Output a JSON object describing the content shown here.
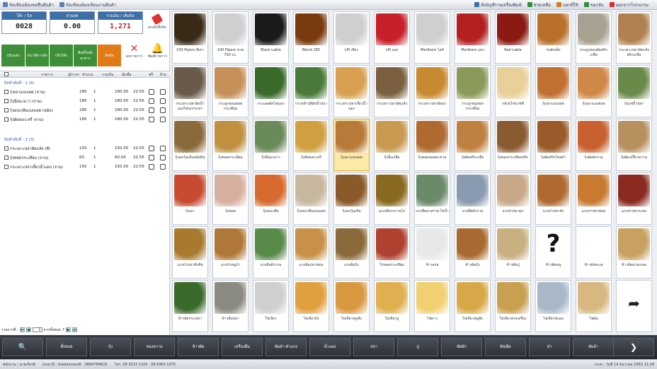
{
  "topbar": {
    "left_links": [
      {
        "label": "ข้อเขียนห้องขอชื่นสินค้า",
        "icon": "sheet-icon"
      },
      {
        "label": "ข้อเขียนห้องเขียนงานสินค้า",
        "icon": "sheet-icon"
      }
    ],
    "right_links": [
      {
        "label": "สั่งบัญชีรายเครื่องพิมพ์",
        "icon": "printer-icon"
      },
      {
        "label": "ช่วยเหลือ",
        "icon": "help-icon"
      },
      {
        "label": "บอกที่ใช้",
        "icon": "info-icon"
      },
      {
        "label": "ขอกลับ",
        "icon": "back-icon"
      },
      {
        "label": "ออกจากโปรแกรม",
        "icon": "exit-icon"
      }
    ]
  },
  "totals": [
    {
      "label": "โต๊ะ / บิล",
      "value": "0028"
    },
    {
      "label": "ส่วนลด",
      "value": "0.00"
    },
    {
      "label": "รวมเงิน / เติมบิล",
      "value": "1,271"
    }
  ],
  "erase_label": "ยกเลิกทั้งบิล",
  "actions": [
    {
      "label": "ปรับแต่ง",
      "color": "#3f8f3a"
    },
    {
      "label": "ประวัติการสั่ง",
      "color": "#3f8f3a"
    },
    {
      "label": "ปรับโต๊ะ",
      "color": "#3f8f3a"
    },
    {
      "label": "พิมพ์ใบสั่งอาหาร",
      "color": "#3f8f3a"
    },
    {
      "label": "ปิดบิล",
      "color": "#e07b18"
    }
  ],
  "ops": [
    {
      "label": "ลบรายการ",
      "glyph": "✕",
      "color": "#d33"
    },
    {
      "label": "พิมพ์รายการ",
      "glyph": "🔔",
      "color": "#f0a020"
    }
  ],
  "table_headers": [
    "รายการ",
    "@ราคา",
    "จำนวน",
    "รวมเงิน",
    "สั่งเมื่อ",
    "ฟรี",
    "ย้าย"
  ],
  "groups": [
    {
      "title": "บิลลำดับที่ : 1 (4)",
      "rows": [
        {
          "name": "กุ้งเผาแบบเดต (จาน)",
          "price": "180",
          "qty": "1",
          "total": "180.00",
          "time": "22:55"
        },
        {
          "name": "กุ้งนึ่งมะนาว (จาน)",
          "price": "180",
          "qty": "1",
          "total": "180.00",
          "time": "22:55"
        },
        {
          "name": "กุ้งอบเกลือแบบเดต (หม้อ)",
          "price": "180",
          "qty": "1",
          "total": "180.00",
          "time": "22:55"
        },
        {
          "name": "กุ้งผัดผงกะหรี่ (จาน)",
          "price": "180",
          "qty": "1",
          "total": "180.00",
          "time": "22:55"
        }
      ]
    },
    {
      "title": "บิลลำดับที่ : 2 (3)",
      "rows": [
        {
          "name": "กระเพาะปลาผัดแห้ง (ที่)",
          "price": "150",
          "qty": "1",
          "total": "150.00",
          "time": "22:55"
        },
        {
          "name": "กุ้งทอดกระเทียม (จาน)",
          "price": "60",
          "qty": "1",
          "total": "60.00",
          "time": "22:55"
        },
        {
          "name": "กระเพาะปลาเจี๋ยวน้ำแดง (จาน)",
          "price": "150",
          "qty": "1",
          "total": "150.00",
          "time": "22:55"
        }
      ]
    }
  ],
  "pager": {
    "label": "รายการที่ :",
    "page": "1",
    "suffix": "จากทั้งหมด",
    "total": "7"
  },
  "products": [
    {
      "name": "100 Pipers สีเทา",
      "c": "#3a2a18"
    },
    {
      "name": "100 Pipers ขวด 700 cc.",
      "c": "#cfcfcf"
    },
    {
      "name": "Black Lable",
      "c": "#1a1a1a"
    },
    {
      "name": "Blend 285",
      "c": "#7a3a10"
    },
    {
      "name": "LM เขียว",
      "c": "#cfcfcf"
    },
    {
      "name": "LM แดง",
      "c": "#c8202a"
    },
    {
      "name": "Marlboro ไลท์",
      "c": "#cfcfcf"
    },
    {
      "name": "Marlboro แดง",
      "c": "#b42020"
    },
    {
      "name": "Red Lable",
      "c": "#8a1a12"
    },
    {
      "name": "กบผัดเผ็ด",
      "c": "#b8702a"
    },
    {
      "name": "กระดูกอ่อนผัดพริกเกลือ",
      "c": "#a8a090"
    },
    {
      "name": "กระเพาะปลาผัดแห้งพริกเกลือ",
      "c": "#b08050"
    },
    {
      "name": "กระเพาะปลาผัดน้ำแดงไข่นกกระทา",
      "c": "#6a5a4a"
    },
    {
      "name": "กระดูกอ่อนทอดกระเทียม",
      "c": "#c69058"
    },
    {
      "name": "กระเฉดผัดไฟแดง",
      "c": "#3a6a2a"
    },
    {
      "name": "กระหล่ำปลีผัดน้ำปลา",
      "c": "#4a7a3a"
    },
    {
      "name": "กระเพาะปลาเจี๋ยวน้ำแดง",
      "c": "#d8a050"
    },
    {
      "name": "กระเพาะปลาผัดแห้ง",
      "c": "#7a6040"
    },
    {
      "name": "กระเพาะปลาผัดฉ่า",
      "c": "#c88a30"
    },
    {
      "name": "กระดูกหมูทอดกระเทียม",
      "c": "#8a9a5a"
    },
    {
      "name": "กล้วยไข่บวชชี",
      "c": "#e8d098"
    },
    {
      "name": "กุ้งเผาแบบเดต",
      "c": "#c07030"
    },
    {
      "name": "กุ้งเผาแบบซอส",
      "c": "#d08848"
    },
    {
      "name": "กุ้งแช่น้ำปลา",
      "c": "#6a8a4a"
    },
    {
      "name": "กุ้งอบวุ้นเส้นหม้อดิน",
      "c": "#8a6a3a"
    },
    {
      "name": "กุ้งทอดกระเทียม",
      "c": "#c09040"
    },
    {
      "name": "กุ้งนึ่งมะนาว",
      "c": "#6a8a5a"
    },
    {
      "name": "กุ้งผัดผงกะหรี่",
      "c": "#d0a040"
    },
    {
      "name": "กุ้งเผาแบบเดต",
      "c": "#b87a38"
    },
    {
      "name": "กุ้งนึ่งเกลือ",
      "c": "#c89a50"
    },
    {
      "name": "กุ้งทอดซอสมะขาม",
      "c": "#b06a30"
    },
    {
      "name": "กุ้งผัดพริกเกลือ",
      "c": "#c08040"
    },
    {
      "name": "กุ้งทอดกระเทียมพริก",
      "c": "#8a5a30"
    },
    {
      "name": "กุ้งผัดพริกไทยดำ",
      "c": "#9a5a2a"
    },
    {
      "name": "กุ้งผัดผักรวม",
      "c": "#c86030"
    },
    {
      "name": "กุ้งผัดเปรี้ยวหวาน",
      "c": "#b89060"
    },
    {
      "name": "กุ้งเผา",
      "c": "#c84a30"
    },
    {
      "name": "กุ้งทอด",
      "c": "#d8b0a0"
    },
    {
      "name": "กุ้งอบเกลือ",
      "c": "#d86a30"
    },
    {
      "name": "กุ้งอบเกลือแบบเดต",
      "c": "#c8b8a0"
    },
    {
      "name": "กุ้งอบวุ้นเส้น",
      "c": "#8a5a2a"
    },
    {
      "name": "แกงเขียวหวานไก่",
      "c": "#8a6a20"
    },
    {
      "name": "แกงจืดสาหร่าย-ไข่น้ำ",
      "c": "#6a8a6a"
    },
    {
      "name": "แกงจืดผักกาด",
      "c": "#8a9ab0"
    },
    {
      "name": "แกงป่าปลาดุก",
      "c": "#c8a888"
    },
    {
      "name": "แกงป่าปลาคัง",
      "c": "#b06a30"
    },
    {
      "name": "แกงป่าปลาช่อน",
      "c": "#c87a30"
    },
    {
      "name": "แกงป่าปลากะพง",
      "c": "#8a2a20"
    },
    {
      "name": "แกงป่าปลาทับทิม",
      "c": "#a87a30"
    },
    {
      "name": "แกงป่าหมูป่า",
      "c": "#b07838"
    },
    {
      "name": "แกงส้มผักรวม",
      "c": "#5a8a4a"
    },
    {
      "name": "แกงส้มปลาช่อน",
      "c": "#c89048"
    },
    {
      "name": "แกงส้มกุ้ง",
      "c": "#8a6a3a"
    },
    {
      "name": "ไก่ทอดกระเทียม",
      "c": "#b04030"
    },
    {
      "name": "ข้าวสวย",
      "c": "#e8e8e8"
    },
    {
      "name": "ข้าวผัดกุ้ง",
      "c": "#a86a30"
    },
    {
      "name": "ข้าวผัดปู",
      "c": "#c8b080"
    },
    {
      "name": "ข้าวผัดหมู",
      "c": "#d0b890"
    },
    {
      "name": "ข้าวผัดทะเล",
      "c": "#ffffff"
    },
    {
      "name": "ข้าวผัดสามเกลอ",
      "c": "#c8a060"
    },
    {
      "name": "ข้าวผัดกระเพรา",
      "c": "#3a6a2a"
    },
    {
      "name": "ข้าวต้มปลา",
      "c": "#8a8a80"
    },
    {
      "name": "ไข่เจียว",
      "c": "#cfcfcf"
    },
    {
      "name": "ไข่เจียวกุ้ง",
      "c": "#e0a040"
    },
    {
      "name": "ไข่เจียวหมูสับ",
      "c": "#d89840"
    },
    {
      "name": "ไข่เจียวปู",
      "c": "#e0b050"
    },
    {
      "name": "ไข่ดาว",
      "c": "#f0d070"
    },
    {
      "name": "ไข่เจียวหมูสับ",
      "c": "#d8a848"
    },
    {
      "name": "ไข่เจียวทรงเครื่อง",
      "c": "#c8a050"
    },
    {
      "name": "ไข่เจียวชะอม",
      "c": "#a8b8c8"
    },
    {
      "name": "ไข่ตุ๋น",
      "c": "#d8b880"
    }
  ],
  "question_index": 57,
  "categories": [
    "ทั้งหมด",
    "กุ้ง",
    "ของหวาน",
    "ข้าวผัด",
    "เครื่องดื่ม",
    "ต้มยำ-ทำแกง",
    "น้ำแดง",
    "ปลา",
    "ปู",
    "ผัดผัก",
    "ผัดเผ็ด",
    "ยำ",
    "ต้มยำ"
  ],
  "status": {
    "user": "พนักงาน : นายเกียรติ",
    "line": "Line ID : freelancecoft , 0894784625",
    "phone": "โทร. 08 3313 1325 , 08 6463 1075",
    "date": "ระบบ : วันที่ 14 ธันวาคม 2563 11:28"
  }
}
